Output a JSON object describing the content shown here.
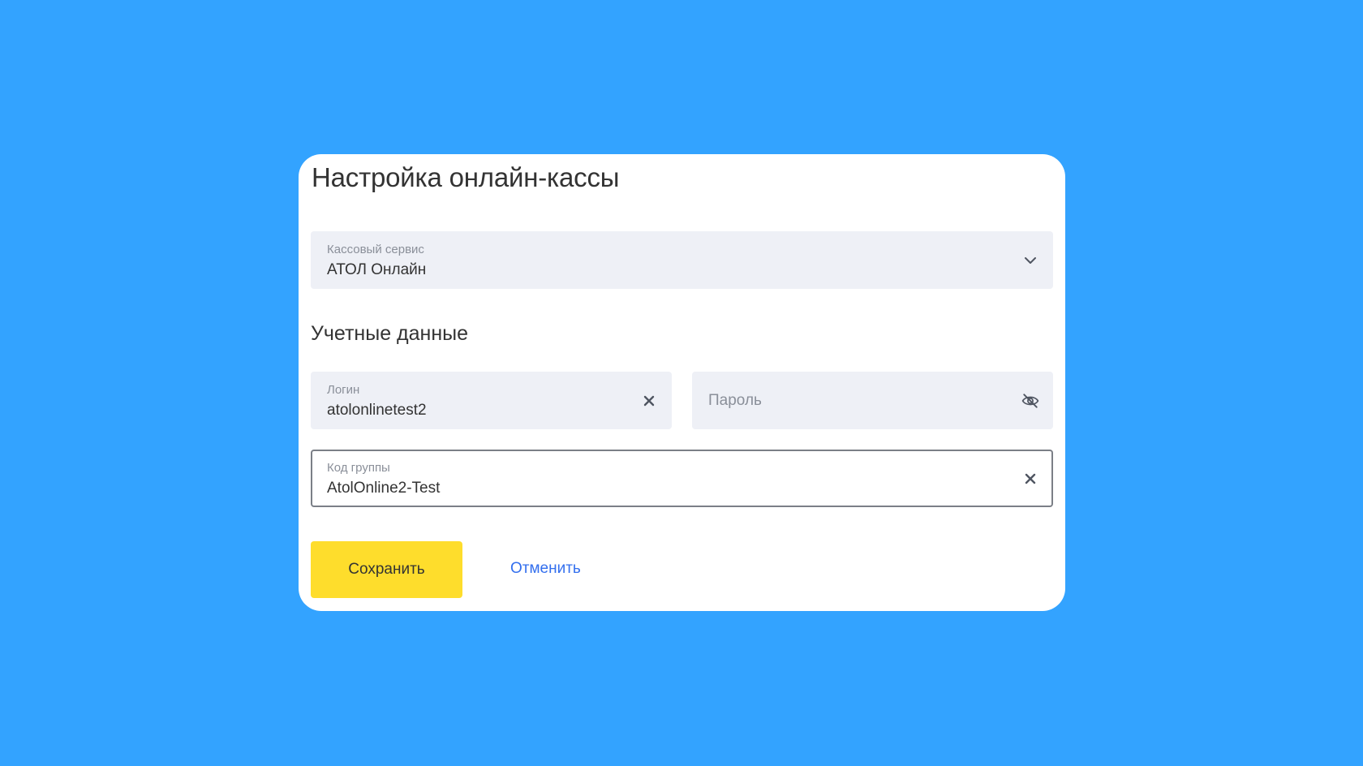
{
  "dialog": {
    "title": "Настройка онлайн-кассы",
    "cash_service": {
      "label": "Кассовый сервис",
      "value": "АТОЛ Онлайн"
    },
    "credentials_title": "Учетные данные",
    "login": {
      "label": "Логин",
      "value": "atolonlinetest2"
    },
    "password": {
      "placeholder": "Пароль"
    },
    "group_code": {
      "label": "Код группы",
      "value": "AtolOnline2-Test"
    },
    "save_label": "Сохранить",
    "cancel_label": "Отменить"
  },
  "icons": {
    "cash_service_dropdown": "chevron-down-icon",
    "login_clear": "close-icon",
    "password_visibility": "eye-off-icon",
    "group_code_clear": "close-icon"
  },
  "colors": {
    "background": "#33a3ff",
    "card": "#ffffff",
    "field": "#eef0f6",
    "primary_button": "#fedd2c",
    "link": "#336fee",
    "text": "#333333",
    "muted_text": "#8a8f99"
  }
}
